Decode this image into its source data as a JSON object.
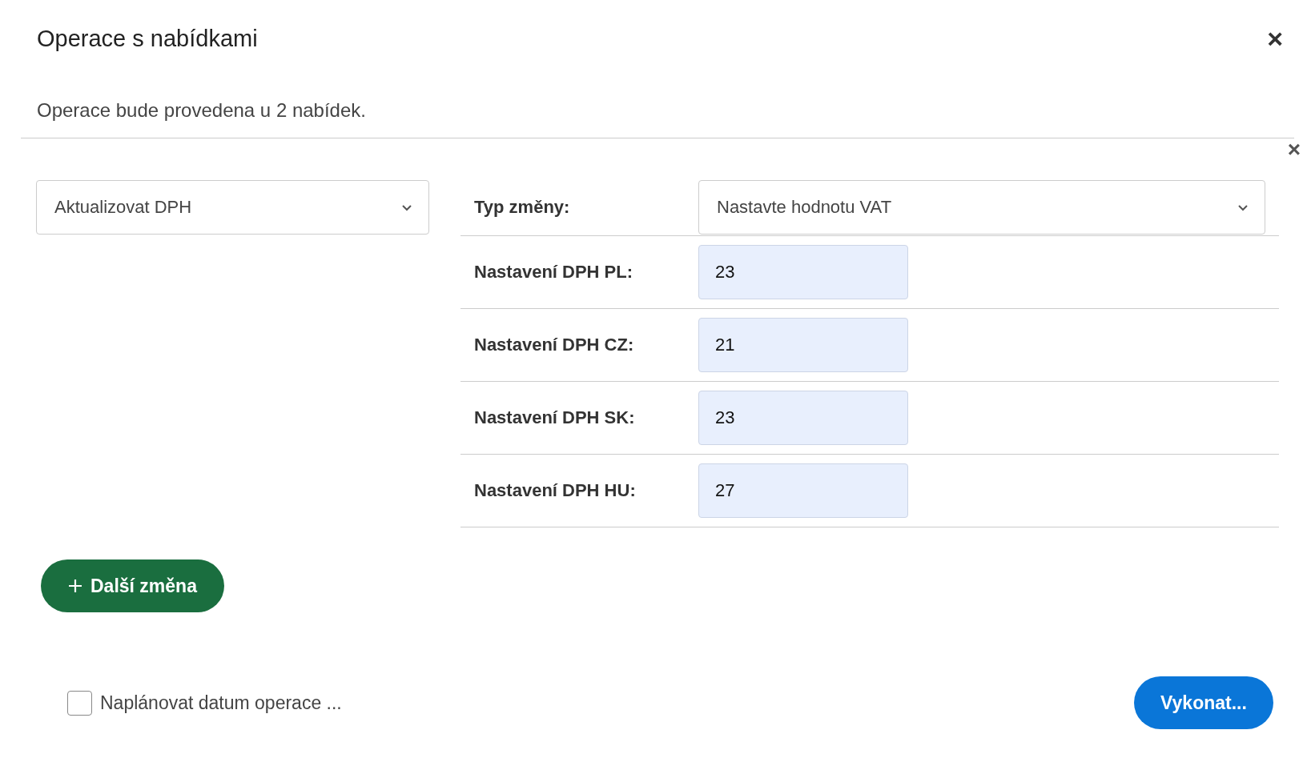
{
  "dialog": {
    "title": "Operace s nabídkami",
    "close": "×"
  },
  "info": "Operace bude provedena u 2 nabídek.",
  "change": {
    "remove": "×",
    "operation": "Aktualizovat DPH",
    "fields": [
      {
        "kind": "select",
        "label": "Typ změny:",
        "value": "Nastavte hodnotu VAT"
      },
      {
        "kind": "input",
        "label": "Nastavení DPH PL:",
        "value": "23"
      },
      {
        "kind": "input",
        "label": "Nastavení DPH CZ:",
        "value": "21"
      },
      {
        "kind": "input",
        "label": "Nastavení DPH SK:",
        "value": "23"
      },
      {
        "kind": "input",
        "label": "Nastavení DPH HU:",
        "value": "27"
      }
    ]
  },
  "add_button": "Další změna",
  "schedule": {
    "label": "Naplánovat datum operace ...",
    "checked": false
  },
  "submit": "Vykonat..."
}
